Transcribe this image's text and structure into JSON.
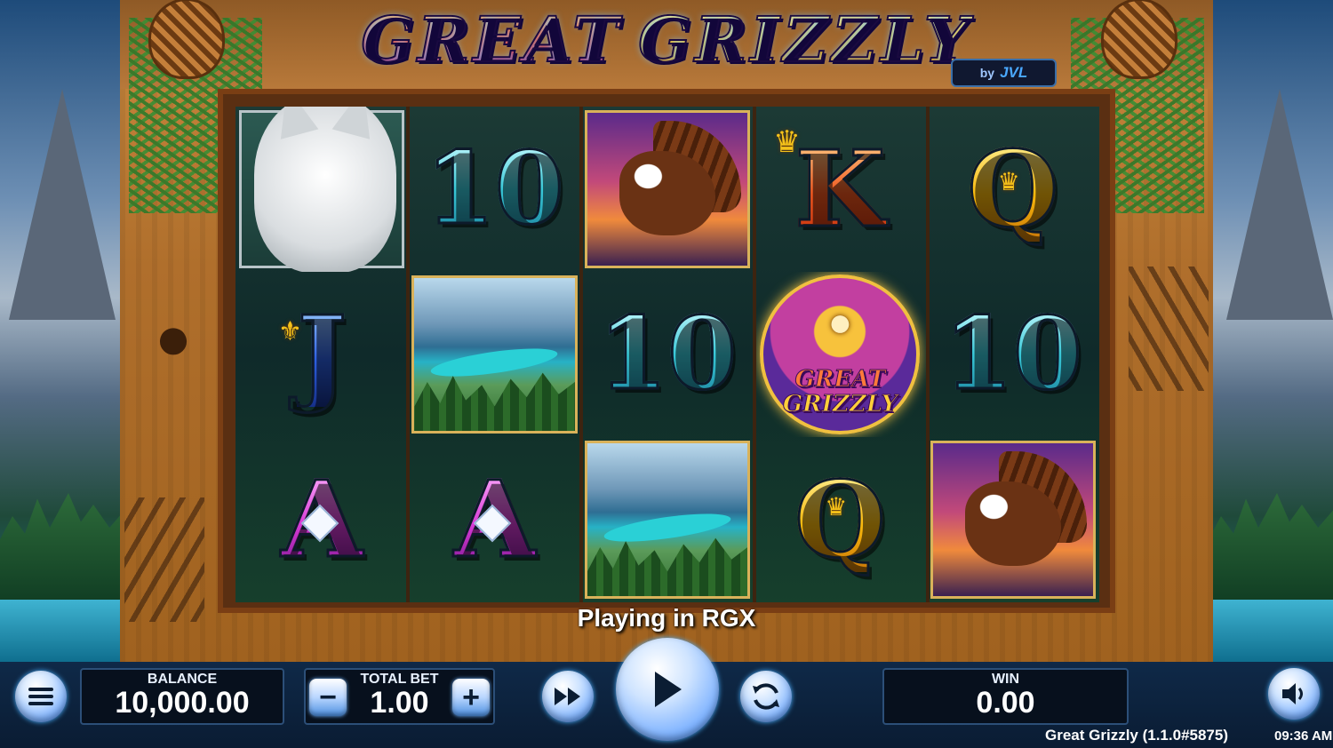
{
  "game": {
    "logo_word1": "GREAT",
    "logo_word2": "GRIZZLY",
    "byline_by": "by",
    "byline_brand": "JVL"
  },
  "reels": {
    "symbols": [
      [
        "wolf",
        "10",
        "eagle",
        "K",
        "Q"
      ],
      [
        "J",
        "lake",
        "10",
        "scatter",
        "10"
      ],
      [
        "A",
        "A",
        "lake",
        "Q",
        "eagle"
      ]
    ],
    "text_10": "10",
    "text_k": "K",
    "text_q": "Q",
    "text_j": "J",
    "text_a": "A",
    "scatter_line1": "GREAT",
    "scatter_line2": "GRIZZLY"
  },
  "status_text": "Playing in RGX",
  "controls": {
    "balance_label": "BALANCE",
    "balance_value": "10,000.00",
    "total_bet_label": "TOTAL BET",
    "total_bet_value": "1.00",
    "minus_label": "−",
    "plus_label": "+",
    "win_label": "WIN",
    "win_value": "0.00"
  },
  "footer": {
    "game_version": "Great Grizzly (1.1.0#5875)",
    "time": "09:36 AM"
  },
  "colors": {
    "bar_bg": "#0f2948",
    "button_glow": "#4ab0ff",
    "frame_wood": "#b06f2c"
  }
}
